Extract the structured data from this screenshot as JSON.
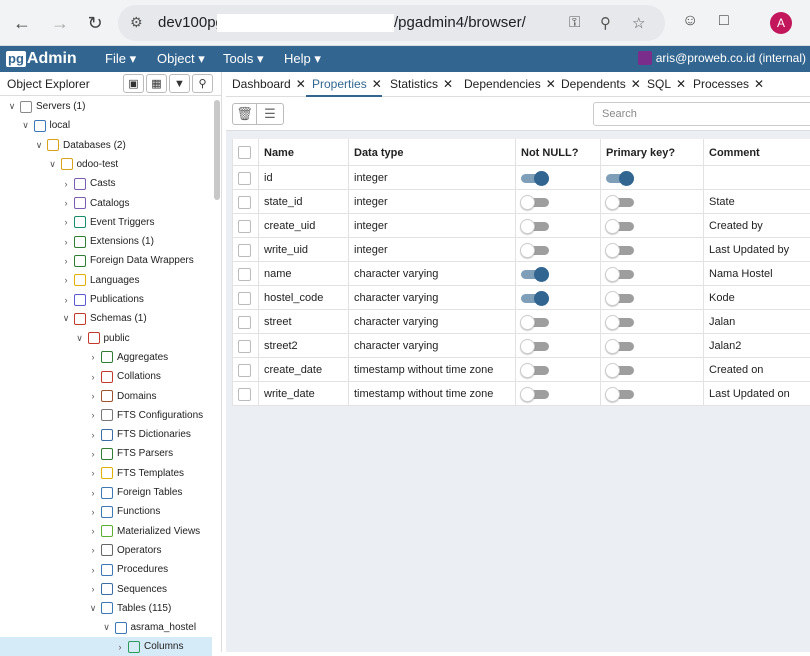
{
  "browser": {
    "url_host": "dev100pg",
    "url_path": "/pgadmin4/browser/",
    "avatar_letter": "A"
  },
  "app": {
    "logo_pg": "pg",
    "logo_admin": "Admin",
    "menus": [
      "File",
      "Object",
      "Tools",
      "Help"
    ],
    "user": "aris@proweb.co.id (internal)",
    "accent": "#326690"
  },
  "object_explorer": {
    "title": "Object Explorer",
    "tree": [
      {
        "label": "Servers",
        "count": "(1)",
        "depth": 0,
        "open": true,
        "icon": "servers-icon"
      },
      {
        "label": "local",
        "count": "",
        "depth": 1,
        "open": true,
        "icon": "server-icon"
      },
      {
        "label": "Databases",
        "count": "(2)",
        "depth": 2,
        "open": true,
        "icon": "databases-icon"
      },
      {
        "label": "odoo-test",
        "count": "",
        "depth": 3,
        "open": true,
        "icon": "database-icon"
      },
      {
        "label": "Casts",
        "count": "",
        "depth": 4,
        "open": false,
        "icon": "casts-icon"
      },
      {
        "label": "Catalogs",
        "count": "",
        "depth": 4,
        "open": false,
        "icon": "catalogs-icon"
      },
      {
        "label": "Event Triggers",
        "count": "",
        "depth": 4,
        "open": false,
        "icon": "event-triggers-icon"
      },
      {
        "label": "Extensions",
        "count": "(1)",
        "depth": 4,
        "open": false,
        "icon": "extensions-icon"
      },
      {
        "label": "Foreign Data Wrappers",
        "count": "",
        "depth": 4,
        "open": false,
        "icon": "fdw-icon"
      },
      {
        "label": "Languages",
        "count": "",
        "depth": 4,
        "open": false,
        "icon": "languages-icon"
      },
      {
        "label": "Publications",
        "count": "",
        "depth": 4,
        "open": false,
        "icon": "publications-icon"
      },
      {
        "label": "Schemas",
        "count": "(1)",
        "depth": 4,
        "open": true,
        "icon": "schemas-icon"
      },
      {
        "label": "public",
        "count": "",
        "depth": 5,
        "open": true,
        "icon": "schema-icon"
      },
      {
        "label": "Aggregates",
        "count": "",
        "depth": 6,
        "open": false,
        "icon": "aggregates-icon"
      },
      {
        "label": "Collations",
        "count": "",
        "depth": 6,
        "open": false,
        "icon": "collations-icon"
      },
      {
        "label": "Domains",
        "count": "",
        "depth": 6,
        "open": false,
        "icon": "domains-icon"
      },
      {
        "label": "FTS Configurations",
        "count": "",
        "depth": 6,
        "open": false,
        "icon": "fts-configurations-icon"
      },
      {
        "label": "FTS Dictionaries",
        "count": "",
        "depth": 6,
        "open": false,
        "icon": "fts-dictionaries-icon"
      },
      {
        "label": "FTS Parsers",
        "count": "",
        "depth": 6,
        "open": false,
        "icon": "fts-parsers-icon"
      },
      {
        "label": "FTS Templates",
        "count": "",
        "depth": 6,
        "open": false,
        "icon": "fts-templates-icon"
      },
      {
        "label": "Foreign Tables",
        "count": "",
        "depth": 6,
        "open": false,
        "icon": "foreign-tables-icon"
      },
      {
        "label": "Functions",
        "count": "",
        "depth": 6,
        "open": false,
        "icon": "functions-icon"
      },
      {
        "label": "Materialized Views",
        "count": "",
        "depth": 6,
        "open": false,
        "icon": "materialized-views-icon"
      },
      {
        "label": "Operators",
        "count": "",
        "depth": 6,
        "open": false,
        "icon": "operators-icon"
      },
      {
        "label": "Procedures",
        "count": "",
        "depth": 6,
        "open": false,
        "icon": "procedures-icon"
      },
      {
        "label": "Sequences",
        "count": "",
        "depth": 6,
        "open": false,
        "icon": "sequences-icon"
      },
      {
        "label": "Tables",
        "count": "(115)",
        "depth": 6,
        "open": true,
        "icon": "tables-icon"
      },
      {
        "label": "asrama_hostel",
        "count": "",
        "depth": 7,
        "open": true,
        "icon": "table-icon"
      },
      {
        "label": "Columns",
        "count": "",
        "depth": 8,
        "open": false,
        "icon": "columns-icon",
        "selected": true
      }
    ]
  },
  "tabs": [
    {
      "label": "Dashboard",
      "active": false
    },
    {
      "label": "Properties",
      "active": true
    },
    {
      "label": "Statistics",
      "active": false
    },
    {
      "label": "Dependencies",
      "active": false
    },
    {
      "label": "Dependents",
      "active": false
    },
    {
      "label": "SQL",
      "active": false
    },
    {
      "label": "Processes",
      "active": false
    }
  ],
  "search": {
    "placeholder": "Search"
  },
  "grid": {
    "headers": [
      "Name",
      "Data type",
      "Not NULL?",
      "Primary key?",
      "Comment"
    ],
    "rows": [
      {
        "name": "id",
        "type": "integer",
        "not_null": true,
        "pk": true,
        "comment": ""
      },
      {
        "name": "state_id",
        "type": "integer",
        "not_null": false,
        "pk": false,
        "comment": "State"
      },
      {
        "name": "create_uid",
        "type": "integer",
        "not_null": false,
        "pk": false,
        "comment": "Created by"
      },
      {
        "name": "write_uid",
        "type": "integer",
        "not_null": false,
        "pk": false,
        "comment": "Last Updated by"
      },
      {
        "name": "name",
        "type": "character varying",
        "not_null": true,
        "pk": false,
        "comment": "Nama Hostel"
      },
      {
        "name": "hostel_code",
        "type": "character varying",
        "not_null": true,
        "pk": false,
        "comment": "Kode"
      },
      {
        "name": "street",
        "type": "character varying",
        "not_null": false,
        "pk": false,
        "comment": "Jalan"
      },
      {
        "name": "street2",
        "type": "character varying",
        "not_null": false,
        "pk": false,
        "comment": "Jalan2"
      },
      {
        "name": "create_date",
        "type": "timestamp without time zone",
        "not_null": false,
        "pk": false,
        "comment": "Created on"
      },
      {
        "name": "write_date",
        "type": "timestamp without time zone",
        "not_null": false,
        "pk": false,
        "comment": "Last Updated on"
      }
    ]
  }
}
